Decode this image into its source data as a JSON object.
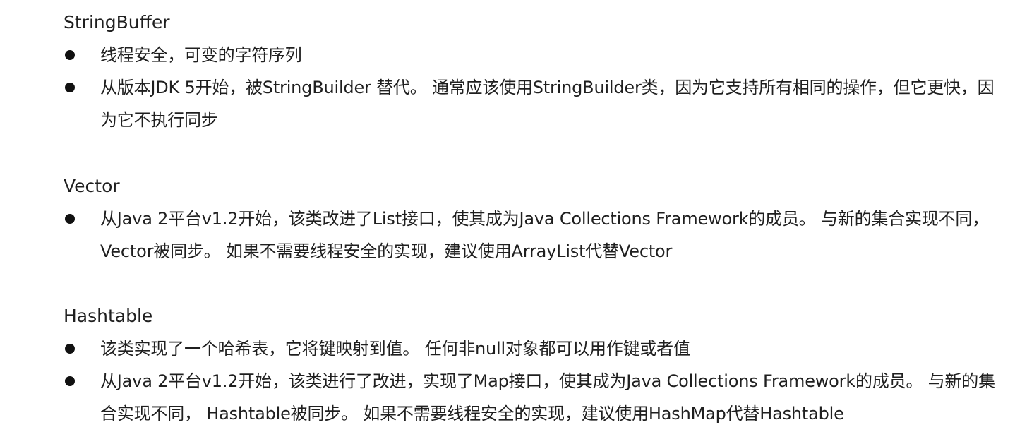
{
  "sections": [
    {
      "title": "StringBuffer",
      "bullets": [
        "线程安全，可变的字符序列",
        "从版本JDK 5开始，被StringBuilder 替代。 通常应该使用StringBuilder类，因为它支持所有相同的操作，但它更快，因为它不执行同步"
      ]
    },
    {
      "title": "Vector",
      "bullets": [
        "从Java 2平台v1.2开始，该类改进了List接口，使其成为Java Collections Framework的成员。 与新的集合实现不同， Vector被同步。 如果不需要线程安全的实现，建议使用ArrayList代替Vector"
      ]
    },
    {
      "title": "Hashtable",
      "bullets": [
        "该类实现了一个哈希表，它将键映射到值。 任何非null对象都可以用作键或者值",
        "从Java 2平台v1.2开始，该类进行了改进，实现了Map接口，使其成为Java Collections Framework的成员。 与新的集合实现不同， Hashtable被同步。 如果不需要线程安全的实现，建议使用HashMap代替Hashtable"
      ]
    }
  ]
}
